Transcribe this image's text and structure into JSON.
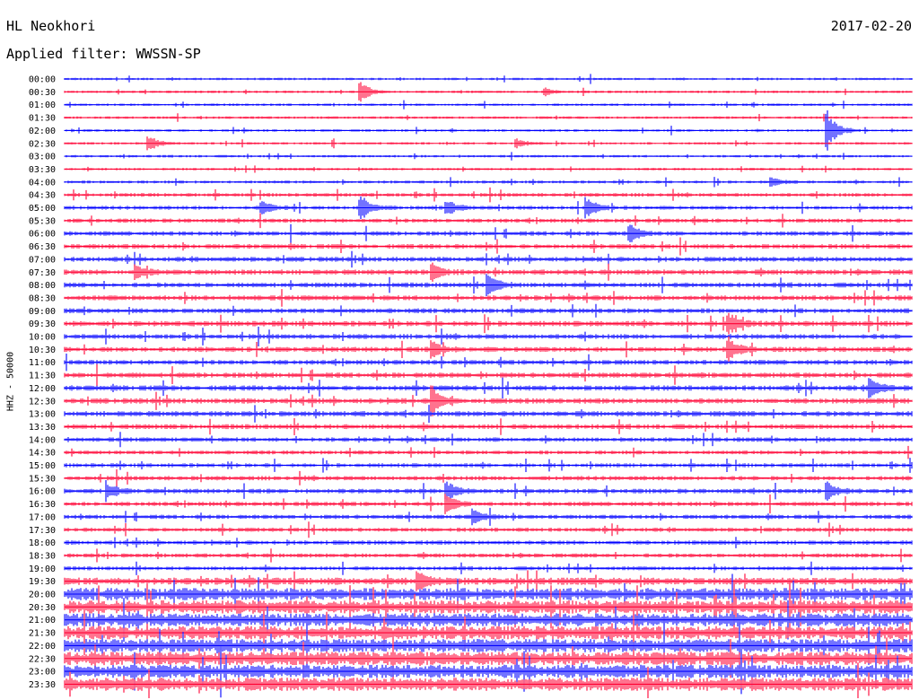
{
  "header": {
    "station": "HL Neokhori",
    "date": "2017-02-20",
    "filter": "Applied filter: WWSSN-SP"
  },
  "channel_label": "HHZ - 50000",
  "colors": {
    "blue": "#0000ff",
    "red": "#ff0033"
  },
  "chart_data": {
    "type": "line",
    "title": "HL Neokhori",
    "subtitle": "Applied filter: WWSSN-SP",
    "ylabel": "HHZ - 50000",
    "row_labels": [
      "00:00",
      "00:30",
      "01:00",
      "01:30",
      "02:00",
      "02:30",
      "03:00",
      "03:30",
      "04:00",
      "04:30",
      "05:00",
      "05:30",
      "06:00",
      "06:30",
      "07:00",
      "07:30",
      "08:00",
      "08:30",
      "09:00",
      "09:30",
      "10:00",
      "10:30",
      "11:00",
      "11:30",
      "12:00",
      "12:30",
      "13:00",
      "13:30",
      "14:00",
      "14:30",
      "15:00",
      "15:30",
      "16:00",
      "16:30",
      "17:00",
      "17:30",
      "18:00",
      "18:30",
      "19:00",
      "19:30",
      "20:00",
      "20:30",
      "21:00",
      "21:30",
      "22:00",
      "22:30",
      "23:00",
      "23:30"
    ],
    "row_colors": [
      "blue",
      "red"
    ],
    "row_duration_minutes": 30,
    "noise_level": [
      1,
      1,
      1,
      1,
      1,
      1,
      1,
      1,
      1.2,
      1.5,
      1.6,
      1.7,
      1.8,
      1.9,
      2,
      2.1,
      2,
      2.1,
      2,
      2.2,
      2,
      2.1,
      2,
      2.1,
      2.2,
      2.2,
      2.2,
      2,
      1.8,
      1.6,
      1.7,
      1.8,
      1.9,
      1.8,
      1.7,
      1.7,
      1.8,
      1.7,
      1.6,
      3,
      5,
      5.5,
      5.5,
      5.5,
      5.5,
      5.5,
      5.5,
      5.5
    ],
    "events": [
      {
        "row": 1,
        "minute": 10.5,
        "amplitude": 10
      },
      {
        "row": 1,
        "minute": 17,
        "amplitude": 4
      },
      {
        "row": 4,
        "minute": 27,
        "amplitude": 22
      },
      {
        "row": 5,
        "minute": 3,
        "amplitude": 7
      },
      {
        "row": 5,
        "minute": 16,
        "amplitude": 5
      },
      {
        "row": 8,
        "minute": 25,
        "amplitude": 6
      },
      {
        "row": 10,
        "minute": 7,
        "amplitude": 8
      },
      {
        "row": 10,
        "minute": 10.5,
        "amplitude": 14
      },
      {
        "row": 10,
        "minute": 13.5,
        "amplitude": 10
      },
      {
        "row": 10,
        "minute": 18.5,
        "amplitude": 10
      },
      {
        "row": 12,
        "minute": 20,
        "amplitude": 10
      },
      {
        "row": 15,
        "minute": 2.5,
        "amplitude": 8
      },
      {
        "row": 15,
        "minute": 13,
        "amplitude": 10
      },
      {
        "row": 16,
        "minute": 15,
        "amplitude": 14
      },
      {
        "row": 19,
        "minute": 23.5,
        "amplitude": 12
      },
      {
        "row": 21,
        "minute": 13,
        "amplitude": 10
      },
      {
        "row": 21,
        "minute": 23.5,
        "amplitude": 14
      },
      {
        "row": 24,
        "minute": 28.5,
        "amplitude": 12
      },
      {
        "row": 25,
        "minute": 13,
        "amplitude": 18
      },
      {
        "row": 32,
        "minute": 1.5,
        "amplitude": 10
      },
      {
        "row": 32,
        "minute": 13.5,
        "amplitude": 12
      },
      {
        "row": 32,
        "minute": 27,
        "amplitude": 10
      },
      {
        "row": 33,
        "minute": 13.5,
        "amplitude": 10
      },
      {
        "row": 34,
        "minute": 14.5,
        "amplitude": 8
      },
      {
        "row": 39,
        "minute": 12.5,
        "amplitude": 12
      }
    ]
  }
}
